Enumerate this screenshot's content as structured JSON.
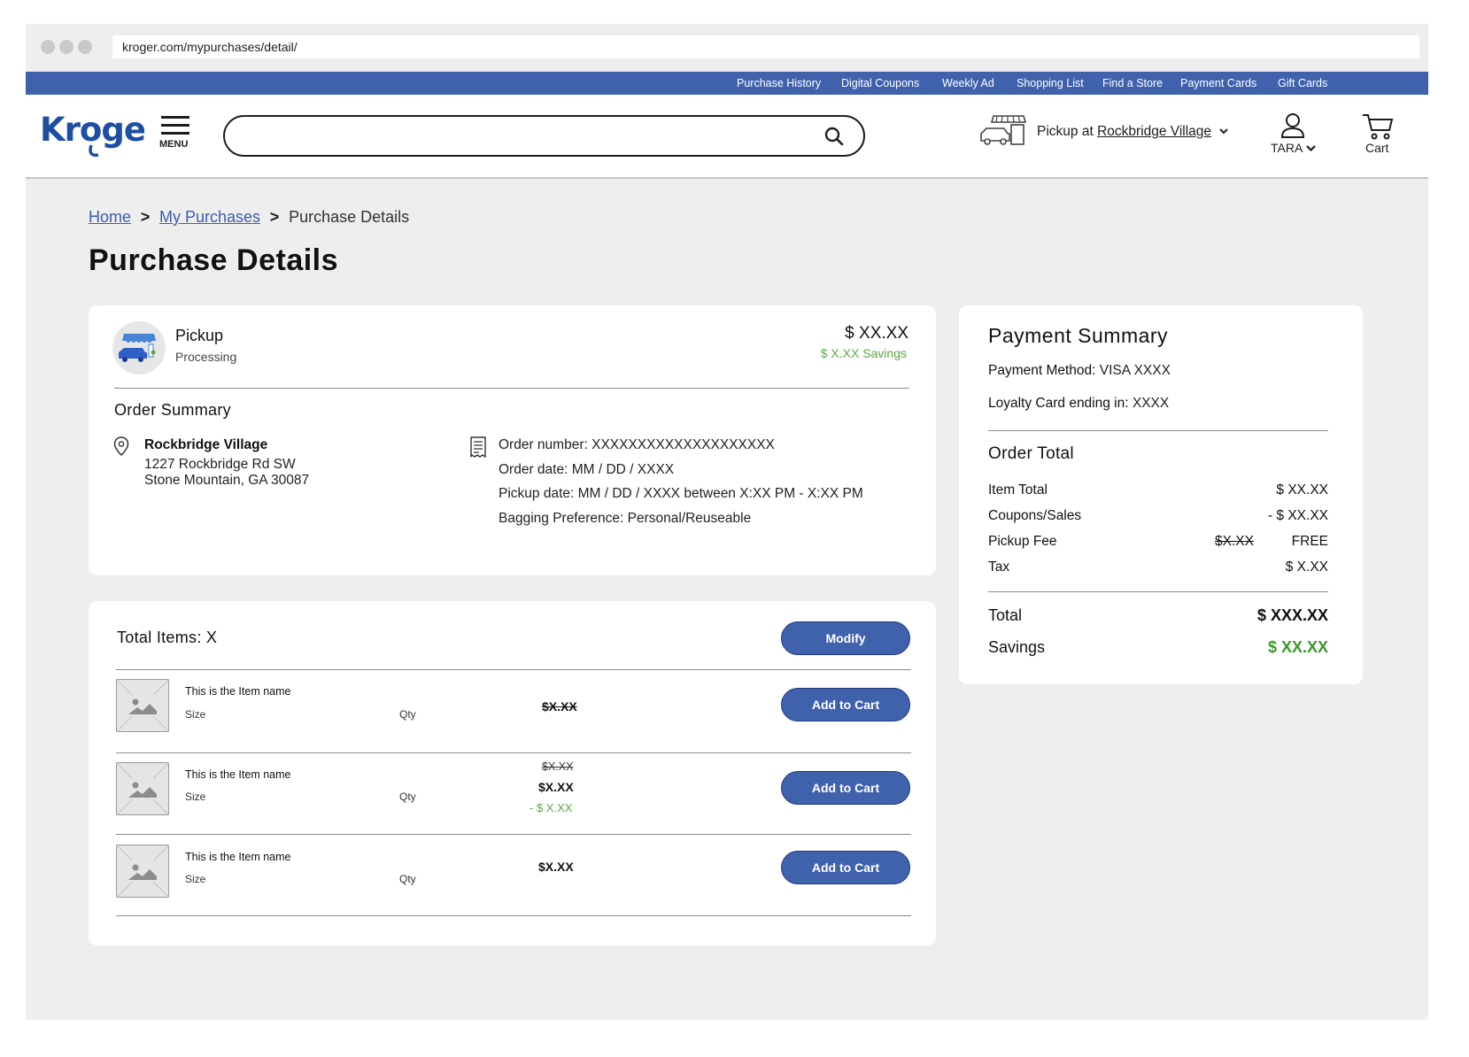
{
  "browser": {
    "url": "kroger.com/mypurchases/detail/"
  },
  "top_nav": [
    "Purchase History",
    "Digital Coupons",
    "Weekly Ad",
    "Shopping List",
    "Find a Store",
    "Payment Cards",
    "Gift Cards"
  ],
  "header": {
    "menu_label": "MENU",
    "search_placeholder": "",
    "pickup_prefix": "Pickup at ",
    "pickup_store": "Rockbridge Village",
    "user_name": "TARA",
    "cart_label": "Cart"
  },
  "breadcrumb": {
    "home": "Home",
    "purchases": "My Purchases",
    "current": "Purchase Details"
  },
  "page_title": "Purchase Details",
  "order": {
    "type": "Pickup",
    "status": "Processing",
    "amount": "$ XX.XX",
    "savings": "$ X.XX Savings",
    "summary_title": "Order Summary",
    "store_name": "Rockbridge Village",
    "address_line1": "1227 Rockbridge Rd SW",
    "address_line2": "Stone Mountain, GA 30087",
    "order_number_label": "Order number:",
    "order_number": " XXXXXXXXXXXXXXXXXXXX",
    "order_date_label": "Order date:",
    "order_date": " MM / DD / XXXX",
    "pickup_date_label": "Pickup date:",
    "pickup_date": " MM / DD / XXXX between X:XX PM - X:XX PM",
    "bagging_label": "Bagging Preference:",
    "bagging": " Personal/Reuseable"
  },
  "items_panel": {
    "total_label": "Total Items: X",
    "modify_label": "Modify",
    "items": [
      {
        "name": "This is the Item name",
        "size": "Size",
        "qty": "Qty",
        "price_strike": "$X.XX",
        "button": "Add to Cart"
      },
      {
        "name": "This is the Item name",
        "size": "Size",
        "qty": "Qty",
        "price_strike": "$X.XX",
        "price": "$X.XX",
        "discount": "- $ X.XX",
        "button": "Add to Cart"
      },
      {
        "name": "This is the Item name",
        "size": "Size",
        "qty": "Qty",
        "price": "$X.XX",
        "button": "Add to Cart"
      }
    ]
  },
  "payment": {
    "title": "Payment Summary",
    "method_label": "Payment Method:",
    "method": " VISA XXXX",
    "loyalty_label": "Loyalty Card ending in:",
    "loyalty": " XXXX",
    "order_total_title": "Order Total",
    "rows": [
      {
        "label": "Item Total",
        "value": "$ XX.XX"
      },
      {
        "label": "Coupons/Sales",
        "value": "- $ XX.XX"
      },
      {
        "label": "Pickup Fee",
        "strike": "$X.XX",
        "value": "FREE"
      },
      {
        "label": "Tax",
        "value": "$ X.XX"
      }
    ],
    "total_label": "Total",
    "total_value": "$ XXX.XX",
    "savings_label": "Savings",
    "savings_value": "$ XX.XX"
  },
  "colors": {
    "brand_blue": "#4062ad",
    "savings_green": "#5aa845",
    "page_bg": "#eeeeee"
  }
}
